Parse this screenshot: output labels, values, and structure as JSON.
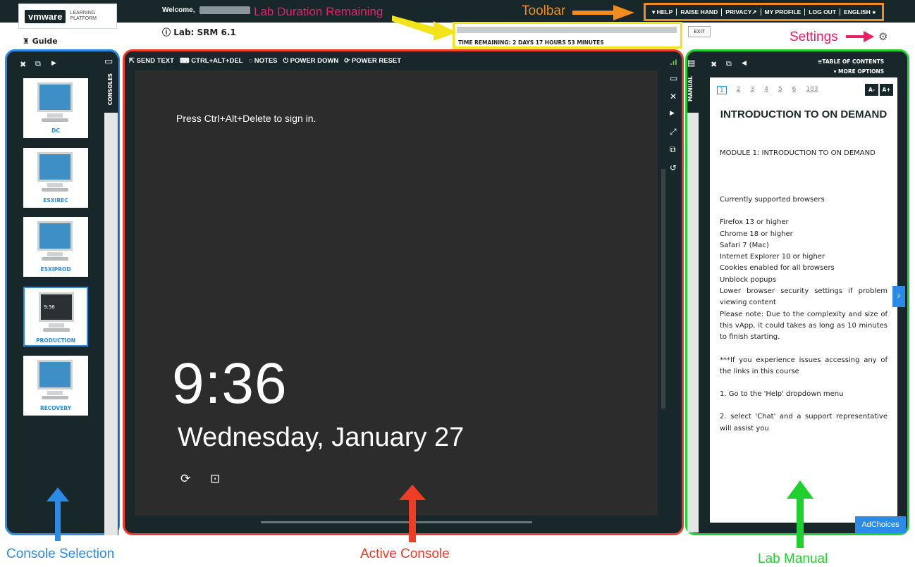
{
  "header": {
    "logo_brand": "vmware",
    "logo_sub1": "LEARNING",
    "logo_sub2": "PLATFORM",
    "welcome": "Welcome,",
    "menu": [
      "▾ HELP",
      "RAISE HAND",
      "PRIVACY↗",
      "MY PROFILE",
      "LOG OUT",
      "ENGLISH"
    ],
    "guide": "Guide",
    "lab_title": "Lab: SRM 6.1",
    "time_remaining": "TIME REMAINING: 2 DAYS 17 HOURS 53 MINUTES",
    "exit": "EXIT"
  },
  "annotations": {
    "duration": "Lab Duration Remaining",
    "toolbar": "Toolbar",
    "settings": "Settings",
    "console_selection": "Console Selection",
    "active_console": "Active Console",
    "lab_manual": "Lab Manual"
  },
  "consoles": {
    "tab_label": "CONSOLES",
    "items": [
      {
        "label": "DC",
        "active": false
      },
      {
        "label": "ESXIREC",
        "active": false
      },
      {
        "label": "ESXIPROD",
        "active": false
      },
      {
        "label": "PRODUCTION",
        "active": true
      },
      {
        "label": "RECOVERY",
        "active": false
      }
    ],
    "mini_clock": "9:36"
  },
  "console": {
    "toolbar": [
      "SEND TEXT",
      "CTRL+ALT+DEL",
      "NOTES",
      "POWER DOWN",
      "POWER RESET"
    ],
    "press_text": "Press Ctrl+Alt+Delete to sign in.",
    "clock": "9:36",
    "date": "Wednesday, January 27"
  },
  "manual": {
    "tab_label": "MANUAL",
    "toc": "TABLE OF CONTENTS",
    "more_options": "MORE OPTIONS",
    "pages": [
      "1",
      "2",
      "3",
      "4",
      "5",
      "6",
      "103"
    ],
    "font_minus": "A-",
    "font_plus": "A+",
    "title": "INTRODUCTION TO ON DEMAND",
    "module": "MODULE 1: INTRODUCTION TO ON DEMAND",
    "lines": [
      "Currently supported browsers",
      "",
      "Firefox 13 or higher",
      "Chrome 18 or higher",
      "Safari 7 (Mac)",
      "Internet Explorer 10 or higher",
      "Cookies enabled for all browsers",
      "Unblock popups",
      "Lower browser security settings if problem viewing content",
      "Please note: Due to the complexity and size of this vApp, it could takes as long as 10 minutes to finish starting.",
      "",
      "***If you experience issues accessing any of the links in this course",
      "",
      "1. Go to the 'Help' dropdown menu",
      "",
      "2. select 'Chat' and a support representative will assist you"
    ],
    "adchoices": "AdChoices"
  }
}
